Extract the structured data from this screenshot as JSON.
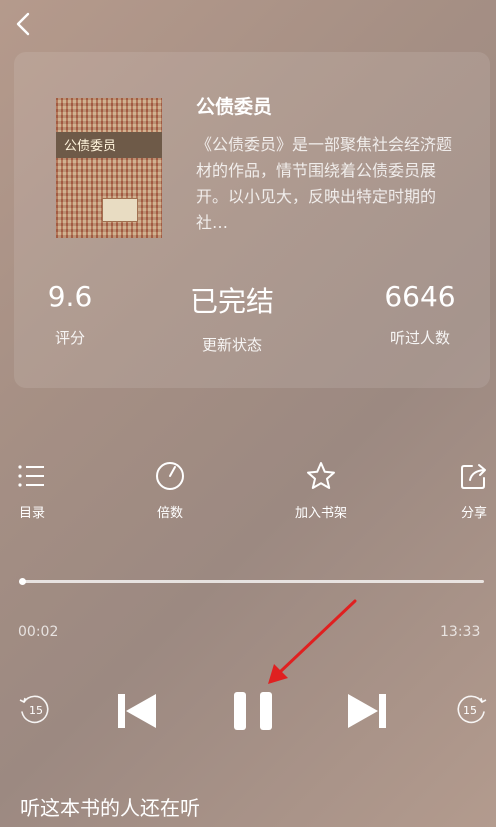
{
  "nav": {
    "back_icon": "chevron-left-icon"
  },
  "book": {
    "cover_title": "公债委员",
    "title": "公债委员",
    "description": "《公债委员》是一部聚焦社会经济题材的作品，情节围绕着公债委员展开。以小见大，反映出特定时期的社…"
  },
  "stats": [
    {
      "value": "9.6",
      "label": "评分"
    },
    {
      "value": "已完结",
      "label": "更新状态"
    },
    {
      "value": "6646",
      "label": "听过人数"
    }
  ],
  "toolbar": [
    {
      "label": "目录",
      "icon": "list-icon"
    },
    {
      "label": "倍数",
      "icon": "speed-icon"
    },
    {
      "label": "加入书架",
      "icon": "star-icon"
    },
    {
      "label": "分享",
      "icon": "share-icon"
    }
  ],
  "player": {
    "current_time": "00:02",
    "total_time": "13:33",
    "progress_fraction": 0.003,
    "rewind_seconds": "15",
    "forward_seconds": "15"
  },
  "related": {
    "title": "听这本书的人还在听"
  },
  "colors": {
    "annotation_arrow": "#e02020"
  }
}
